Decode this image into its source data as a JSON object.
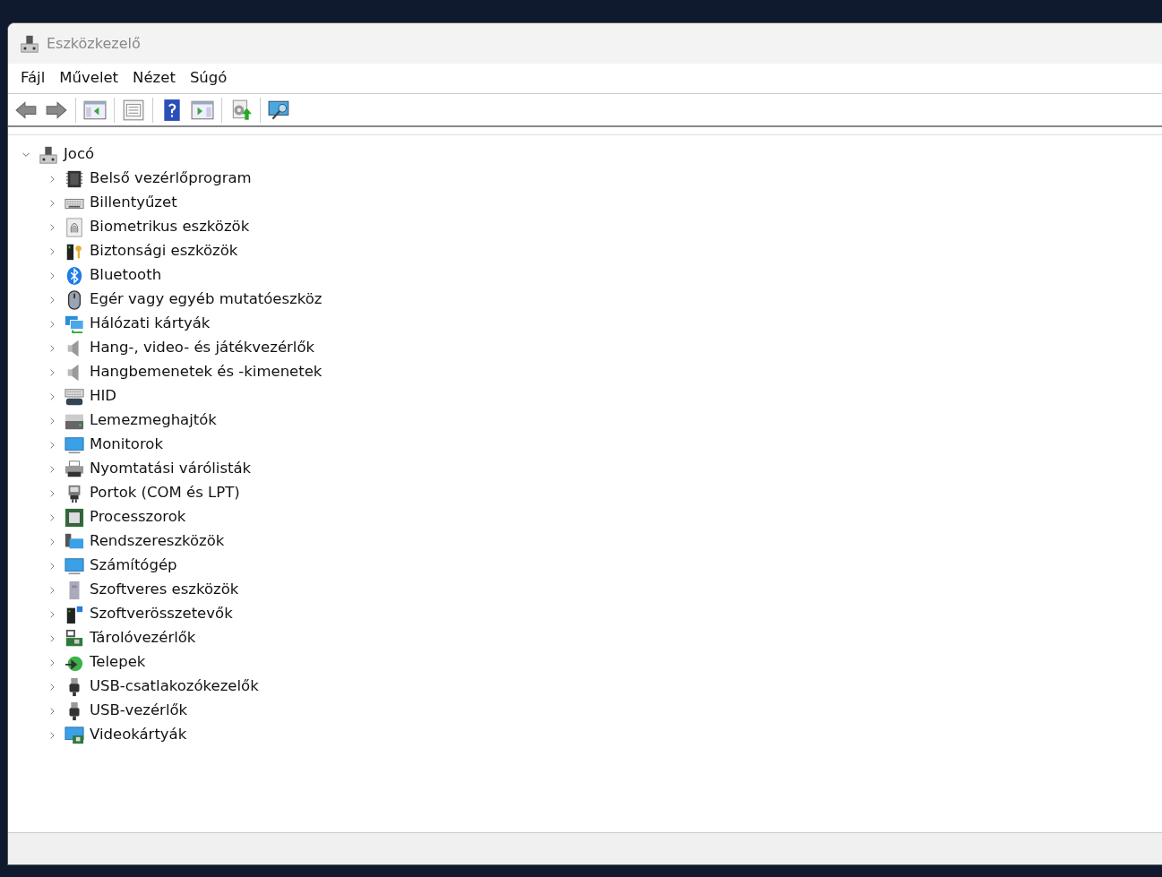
{
  "window": {
    "title": "Eszközkezelő"
  },
  "menu": [
    "Fájl",
    "Művelet",
    "Nézet",
    "Súgó"
  ],
  "toolbar": [
    {
      "kind": "back"
    },
    {
      "kind": "forward"
    },
    {
      "kind": "separator"
    },
    {
      "kind": "tree-pane"
    },
    {
      "kind": "separator"
    },
    {
      "kind": "properties"
    },
    {
      "kind": "separator"
    },
    {
      "kind": "help"
    },
    {
      "kind": "action-pane"
    },
    {
      "kind": "separator"
    },
    {
      "kind": "update"
    },
    {
      "kind": "separator"
    },
    {
      "kind": "scan"
    }
  ],
  "tree": {
    "label": "Jocó",
    "kind": "computer-node",
    "expanded": true,
    "children": [
      {
        "label": "Belső vezérlőprogram",
        "kind": "chip",
        "expanded": false
      },
      {
        "label": "Billentyűzet",
        "kind": "keyboard",
        "expanded": false
      },
      {
        "label": "Biometrikus eszközök",
        "kind": "fingerprint",
        "expanded": false
      },
      {
        "label": "Biztonsági eszközök",
        "kind": "security",
        "expanded": false
      },
      {
        "label": "Bluetooth",
        "kind": "bluetooth",
        "expanded": false
      },
      {
        "label": "Egér vagy egyéb mutatóeszköz",
        "kind": "mouse",
        "expanded": false
      },
      {
        "label": "Hálózati kártyák",
        "kind": "network",
        "expanded": false
      },
      {
        "label": "Hang-, video- és játékvezérlők",
        "kind": "speaker",
        "expanded": false
      },
      {
        "label": "Hangbemenetek és -kimenetek",
        "kind": "speaker",
        "expanded": false
      },
      {
        "label": "HID",
        "kind": "hid",
        "expanded": false
      },
      {
        "label": "Lemezmeghajtók",
        "kind": "disk",
        "expanded": false
      },
      {
        "label": "Monitorok",
        "kind": "monitor",
        "expanded": false
      },
      {
        "label": "Nyomtatási várólisták",
        "kind": "printer",
        "expanded": false
      },
      {
        "label": "Portok (COM és LPT)",
        "kind": "port",
        "expanded": false
      },
      {
        "label": "Processzorok",
        "kind": "cpu",
        "expanded": false
      },
      {
        "label": "Rendszereszközök",
        "kind": "system",
        "expanded": false
      },
      {
        "label": "Számítógép",
        "kind": "monitor",
        "expanded": false
      },
      {
        "label": "Szoftveres eszközök",
        "kind": "software-device",
        "expanded": false
      },
      {
        "label": "Szoftverösszetevők",
        "kind": "software-component",
        "expanded": false
      },
      {
        "label": "Tárolóvezérlők",
        "kind": "storage",
        "expanded": false
      },
      {
        "label": "Telepek",
        "kind": "battery",
        "expanded": false
      },
      {
        "label": "USB-csatlakozókezelők",
        "kind": "usb",
        "expanded": false
      },
      {
        "label": "USB-vezérlők",
        "kind": "usb",
        "expanded": false
      },
      {
        "label": "Videokártyák",
        "kind": "display-adapter",
        "expanded": false
      }
    ]
  }
}
